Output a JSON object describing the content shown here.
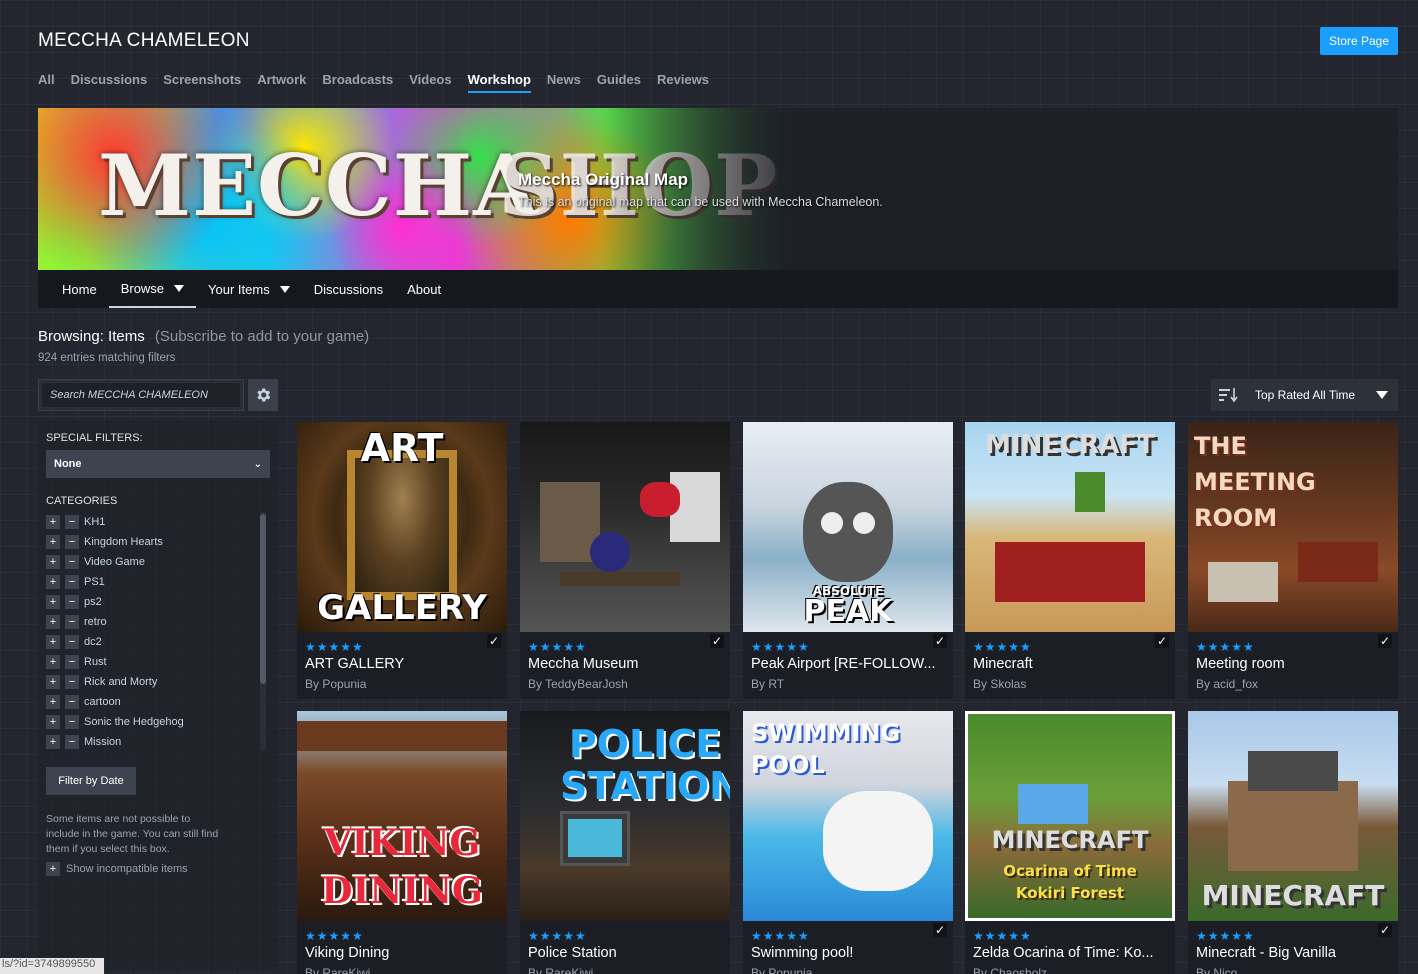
{
  "header": {
    "app_title": "MECCHA CHAMELEON",
    "store_button": "Store Page",
    "tabs": [
      {
        "label": "All"
      },
      {
        "label": "Discussions"
      },
      {
        "label": "Screenshots"
      },
      {
        "label": "Artwork"
      },
      {
        "label": "Broadcasts"
      },
      {
        "label": "Videos"
      },
      {
        "label": "Workshop"
      },
      {
        "label": "News"
      },
      {
        "label": "Guides"
      },
      {
        "label": "Reviews"
      }
    ],
    "active_tab": "Workshop"
  },
  "banner": {
    "logo_word_1": "MECCHA",
    "logo_word_2": "SHOP",
    "title": "Meccha Original Map",
    "description": "This is an original map that can be used with Meccha Chameleon."
  },
  "subnav": {
    "items": [
      {
        "label": "Home"
      },
      {
        "label": "Browse"
      },
      {
        "label": "Your Items"
      },
      {
        "label": "Discussions"
      },
      {
        "label": "About"
      }
    ]
  },
  "browse": {
    "heading": "Browsing: Items",
    "hint": "(Subscribe to add to your game)",
    "entries": "924 entries matching filters"
  },
  "search": {
    "placeholder": "Search MECCHA CHAMELEON"
  },
  "sort": {
    "label": "Top Rated All Time"
  },
  "sidebar": {
    "special_filters_label": "SPECIAL FILTERS:",
    "special_filters_value": "None",
    "categories_label": "CATEGORIES",
    "categories": [
      "KH1",
      "Kingdom Hearts",
      "Video Game",
      "PS1",
      "ps2",
      "retro",
      "dc2",
      "Rust",
      "Rick and Morty",
      "cartoon",
      "Sonic the Hedgehog",
      "Mission"
    ],
    "filter_by_date": "Filter by Date",
    "incompat_text": "Some items are not possible to include in the game. You can still find them if you select this box.",
    "show_incompat": "Show incompatible items"
  },
  "items": [
    {
      "title": "ART GALLERY",
      "author": "By Popunia",
      "stars": "★★★★★",
      "thumb_top": "ART",
      "thumb_bottom": "GALLERY"
    },
    {
      "title": "Meccha Museum",
      "author": "By TeddyBearJosh",
      "stars": "★★★★★",
      "thumb_top": "",
      "thumb_bottom": ""
    },
    {
      "title": "Peak Airport [RE-FOLLOW...",
      "author": "By RT",
      "stars": "★★★★★",
      "thumb_top": "ABSOLUTE",
      "thumb_bottom": "PEAK"
    },
    {
      "title": "Minecraft",
      "author": "By Skolas",
      "stars": "★★★★★",
      "thumb_top": "MINECRAFT",
      "thumb_bottom": ""
    },
    {
      "title": "Meeting room",
      "author": "By acid_fox",
      "stars": "★★★★★",
      "thumb_top": "THE MEETING ROOM",
      "thumb_bottom": ""
    },
    {
      "title": "Viking Dining",
      "author": "By RareKiwi",
      "stars": "★★★★★",
      "thumb_top": "",
      "thumb_bottom": "VIKING DINING"
    },
    {
      "title": "Police Station",
      "author": "By RareKiwi",
      "stars": "★★★★★",
      "thumb_top": "POLICE STATION",
      "thumb_bottom": ""
    },
    {
      "title": "Swimming pool!",
      "author": "By Popunia",
      "stars": "★★★★★",
      "thumb_top": "SWIMMING POOL",
      "thumb_bottom": ""
    },
    {
      "title": "Zelda Ocarina of Time: Ko...",
      "author": "By Chaosholz",
      "stars": "★★★★★",
      "thumb_top": "MINECRAFT",
      "thumb_bottom": "Ocarina of Time Kokiri Forest"
    },
    {
      "title": "Minecraft - Big Vanilla",
      "author": "By Nico",
      "stars": "★★★★★",
      "thumb_top": "",
      "thumb_bottom": "MINECRAFT"
    }
  ],
  "statusbar": {
    "url": "ls/?id=3749899550"
  }
}
